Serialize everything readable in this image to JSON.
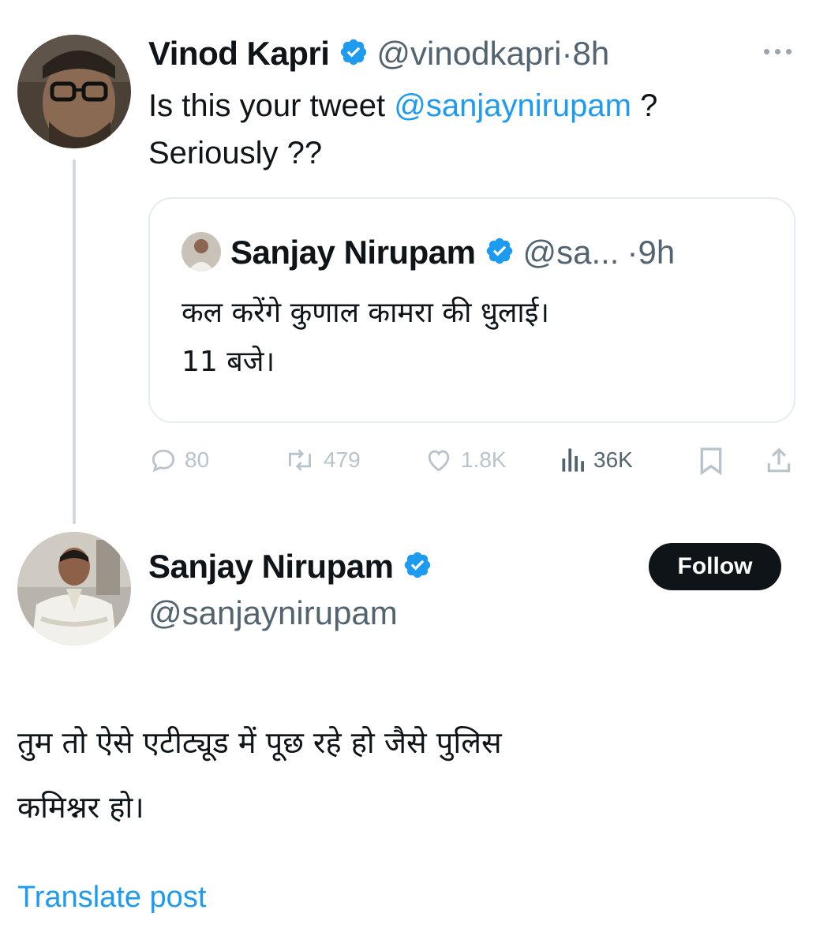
{
  "tweet": {
    "author_name": "Vinod Kapri",
    "handle": "@vinodkapri",
    "dot": "·",
    "time": "8h",
    "text_part1": "Is this your tweet ",
    "mention": "@sanjaynirupam",
    "text_part2": " ?",
    "text_line2": "Seriously ??",
    "quote": {
      "author_name": "Sanjay Nirupam",
      "handle": "@sa...",
      "dot": "·",
      "time": "9h",
      "line1": "कल करेंगे कुणाल कामरा की धुलाई।",
      "line2": "11 बजे।"
    },
    "stats": {
      "replies": "80",
      "reposts": "479",
      "likes": "1.8K",
      "views": "36K"
    }
  },
  "reply": {
    "author_name": "Sanjay Nirupam",
    "handle": "@sanjaynirupam",
    "follow_label": "Follow",
    "line1": "तुम तो ऐसे एटीट्यूड में पूछ रहे हो जैसे पुलिस",
    "line2": "कमिश्नर हो।",
    "translate_label": "Translate post"
  },
  "colors": {
    "accent": "#1d9bf0",
    "text": "#0f1419",
    "muted": "#536471",
    "faint": "#b9c3cb"
  }
}
